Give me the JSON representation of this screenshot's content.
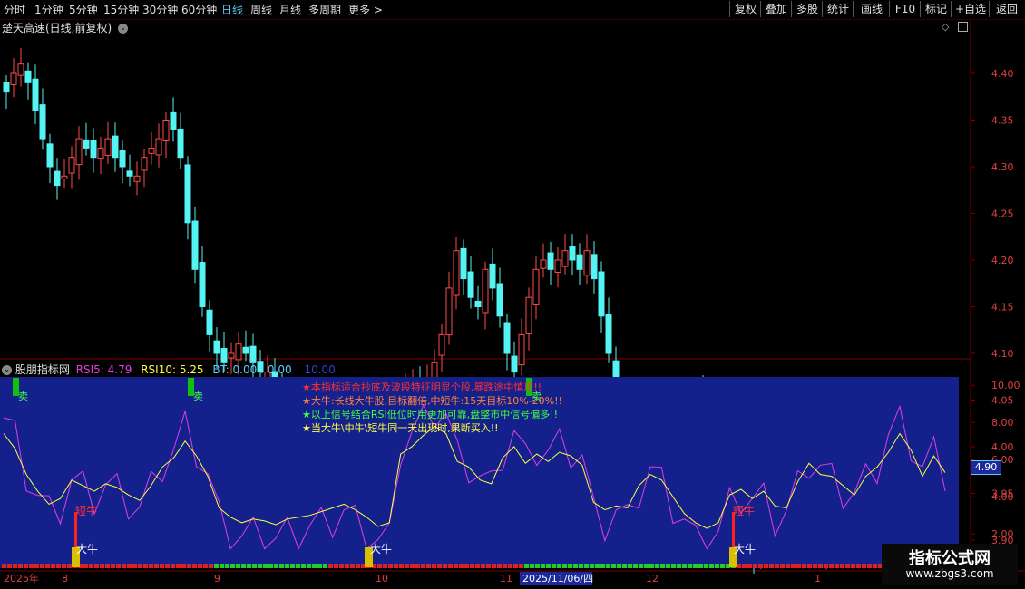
{
  "toolbar": {
    "periods": [
      "分时",
      "1分钟",
      "5分钟",
      "15分钟",
      "30分钟",
      "60分钟",
      "日线",
      "周线",
      "月线",
      "多周期",
      "更多 >"
    ],
    "active_period": "日线",
    "right_buttons": [
      "复权",
      "叠加",
      "多股",
      "统计",
      "画线",
      "F10",
      "标记",
      "+自选",
      "返回"
    ]
  },
  "main_chart": {
    "title": "楚天高速(日线,前复权)",
    "y_ticks": [
      "4.40",
      "4.35",
      "4.30",
      "4.25",
      "4.20",
      "4.15",
      "4.10",
      "4.05",
      "4.00",
      "3.95",
      "3.90"
    ],
    "up_color": "#ff4a4a",
    "down_color": "#54f4f4"
  },
  "indicator": {
    "name": "股朋指标网",
    "rsi5_label": "RSI5: 4.79",
    "rsi10_label": "RSI10: 5.25",
    "bt_label": "BT: 0.00 : 0.00",
    "extra_label": "10.00",
    "y_ticks": [
      "10.00",
      "8.00",
      "6.00",
      "4.00",
      "2.00"
    ],
    "current_value": "4.90",
    "notes": [
      "★本指标适合抄底及波段特征明显个股,暴跌途中慎用!!",
      "★大牛:长线大牛股,目标翻倍,中短牛:15天目标10%-20%!!",
      "★以上信号结合RSI低位时用更加可靠,盘整市中信号偏多!!",
      "★当大牛\\中牛\\短牛同一天出现时,果断买入!!"
    ],
    "sell_label": "卖",
    "short_bull_label": "短牛",
    "big_bull_label": "大牛",
    "bg_color": "#14208c"
  },
  "x_axis": {
    "labels": [
      "2025年",
      "8",
      "9",
      "10",
      "11",
      "2025/11/06/四",
      "12",
      "1"
    ]
  },
  "watermark": {
    "line1": "指标公式网",
    "line2": "www.zbgs3.com"
  }
}
